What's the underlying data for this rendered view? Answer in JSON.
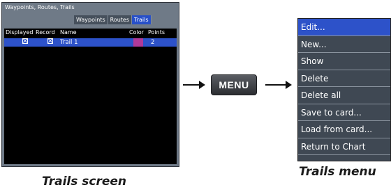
{
  "screen": {
    "title": "Waypoints, Routes, Trails",
    "tabs": [
      "Waypoints",
      "Routes",
      "Trails"
    ],
    "active_tab": "Trails",
    "columns": [
      "Displayed",
      "Record",
      "Name",
      "Color",
      "Points"
    ],
    "trail": {
      "name": "Trail 1",
      "points": "2",
      "color": "#b03a9a",
      "displayed": true,
      "record": true
    }
  },
  "menu_key_label": "MENU",
  "menu": {
    "items": [
      "Edit...",
      "New...",
      "Show",
      "Delete",
      "Delete all",
      "Save to card...",
      "Load from card...",
      "Return to Chart"
    ],
    "highlighted_index": 0
  },
  "captions": {
    "screen": "Trails screen",
    "menu": "Trails menu"
  },
  "colors": {
    "selection": "#2d52c9",
    "screen_bg": "#000000",
    "frame": "#6f7a87"
  }
}
